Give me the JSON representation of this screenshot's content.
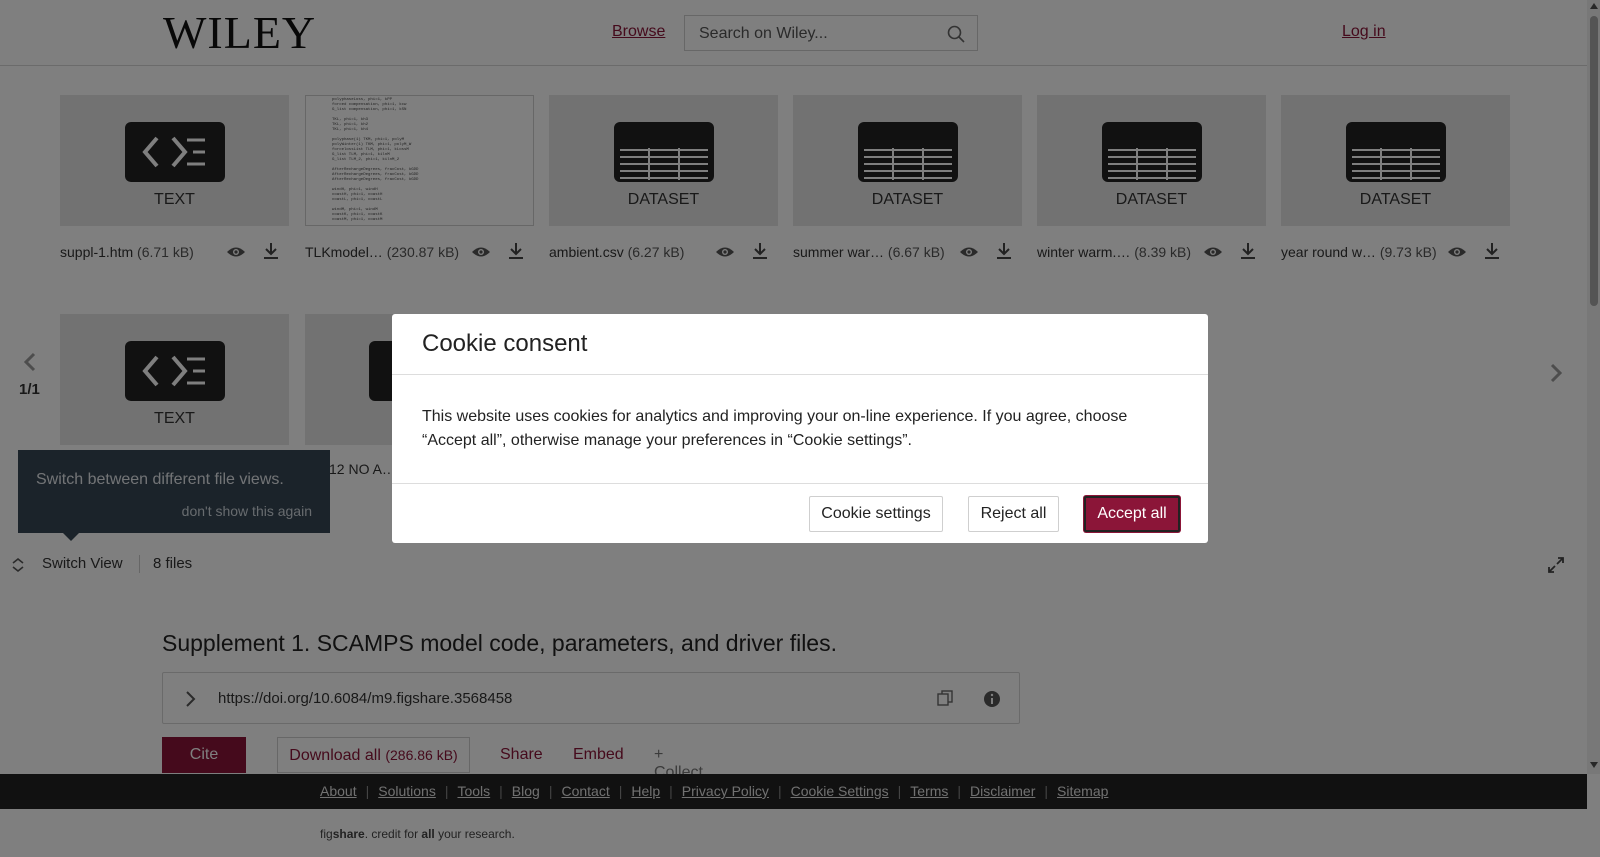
{
  "header": {
    "logo": "WILEY",
    "browse": "Browse",
    "search_placeholder": "Search on Wiley...",
    "login": "Log in"
  },
  "files": [
    {
      "type": "TEXT",
      "name": "suppl-1.htm",
      "size": "(6.71 kB)",
      "icon": "code-icon"
    },
    {
      "type": "",
      "name": "TLKmodel…",
      "size": "(230.87 kB)",
      "icon": "document-preview"
    },
    {
      "type": "DATASET",
      "name": "ambient.csv",
      "size": "(6.27 kB)",
      "icon": "table-icon"
    },
    {
      "type": "DATASET",
      "name": "summer war…",
      "size": "(6.67 kB)",
      "icon": "table-icon"
    },
    {
      "type": "DATASET",
      "name": "winter warm.…",
      "size": "(8.39 kB)",
      "icon": "table-icon"
    },
    {
      "type": "DATASET",
      "name": "year round w…",
      "size": "(9.73 kB)",
      "icon": "table-icon"
    },
    {
      "type": "TEXT",
      "name": "",
      "size": "",
      "icon": "code-icon"
    },
    {
      "type": "",
      "name": "12 NO A…",
      "size": "",
      "icon": "code-icon"
    }
  ],
  "pager": "1/1",
  "tooltip": {
    "text": "Switch between different file views.",
    "dismiss": "don't show this again"
  },
  "toolbar": {
    "switch_view": "Switch View",
    "file_count": "8 files"
  },
  "item": {
    "title": "Supplement 1. SCAMPS model code, parameters, and driver files.",
    "doi": "https://doi.org/10.6084/m9.figshare.3568458",
    "cite": "Cite",
    "download_all": "Download all",
    "download_size": "(286.86 kB)",
    "share": "Share",
    "embed": "Embed",
    "collect": "+ Collect"
  },
  "footer": {
    "links": [
      "About",
      "Solutions",
      "Tools",
      "Blog",
      "Contact",
      "Help",
      "Privacy Policy",
      "Cookie Settings",
      "Terms",
      "Disclaimer",
      "Sitemap"
    ],
    "tagline_pre": "fig",
    "tagline_brand": "share",
    "tagline_mid": ". credit for ",
    "tagline_all": "all",
    "tagline_post": " your research."
  },
  "cookie": {
    "title": "Cookie consent",
    "body": "This website uses cookies for analytics and improving your on-line experience. If you agree, choose “Accept all”, otherwise manage your preferences in “Cookie settings”.",
    "settings": "Cookie settings",
    "reject": "Reject all",
    "accept": "Accept all"
  },
  "colors": {
    "brand": "#8b1538",
    "tooltip_bg": "#364655",
    "footer_bg": "#222222"
  }
}
